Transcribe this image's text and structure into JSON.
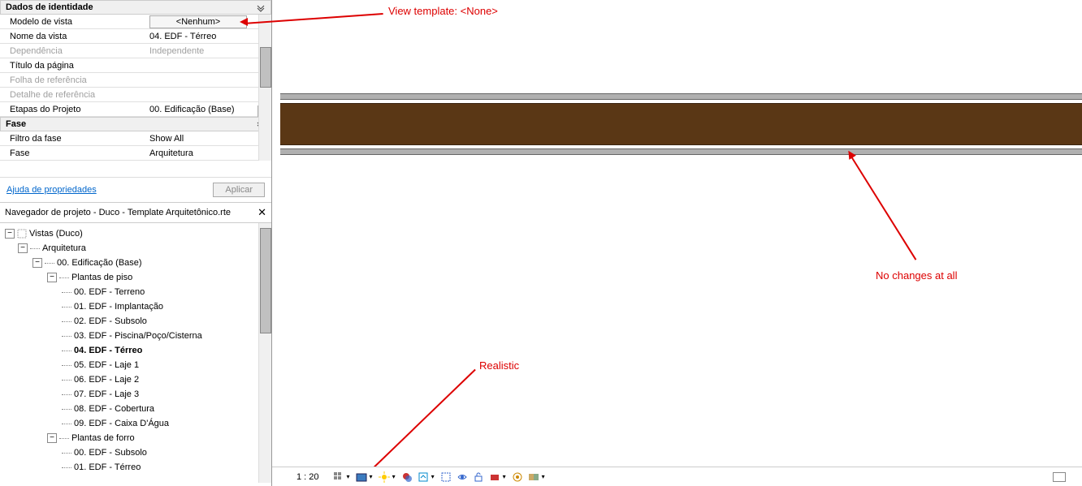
{
  "properties": {
    "sections": {
      "identity": {
        "title": "Dados de identidade"
      },
      "phase": {
        "title": "Fase"
      }
    },
    "rows": {
      "view_template": {
        "label": "Modelo de vista",
        "value": "<Nenhum>"
      },
      "view_name": {
        "label": "Nome da vista",
        "value": "04. EDF - Térreo"
      },
      "dependency": {
        "label": "Dependência",
        "value": "Independente"
      },
      "page_title": {
        "label": "Título da página",
        "value": ""
      },
      "ref_sheet": {
        "label": "Folha de referência",
        "value": ""
      },
      "ref_detail": {
        "label": "Detalhe de referência",
        "value": ""
      },
      "project_stage": {
        "label": "Etapas do Projeto",
        "value": "00. Edificação (Base)"
      },
      "phase_filter": {
        "label": "Filtro da fase",
        "value": "Show All"
      },
      "phase": {
        "label": "Fase",
        "value": "Arquitetura"
      }
    },
    "help_link": "Ajuda de propriedades",
    "apply_label": "Aplicar"
  },
  "browser": {
    "title": "Navegador de projeto - Duco - Template Arquitetônico.rte",
    "root": "Vistas (Duco)",
    "arch": "Arquitetura",
    "base": "00. Edificação (Base)",
    "floor_plans": "Plantas de piso",
    "ceiling_plans": "Plantas de forro",
    "plans": [
      "00. EDF - Terreno",
      "01. EDF - Implantação",
      "02. EDF - Subsolo",
      "03. EDF - Piscina/Poço/Cisterna",
      "04. EDF - Térreo",
      "05. EDF - Laje 1",
      "06. EDF - Laje 2",
      "07. EDF - Laje 3",
      "08. EDF - Cobertura",
      "09. EDF - Caixa D'Água"
    ],
    "ceiling": [
      "00. EDF - Subsolo",
      "01. EDF - Térreo"
    ]
  },
  "annotations": {
    "view_template": "View template: <None>",
    "no_changes": "No changes at all",
    "realistic": "Realistic"
  },
  "viewbar": {
    "scale": "1 : 20"
  }
}
